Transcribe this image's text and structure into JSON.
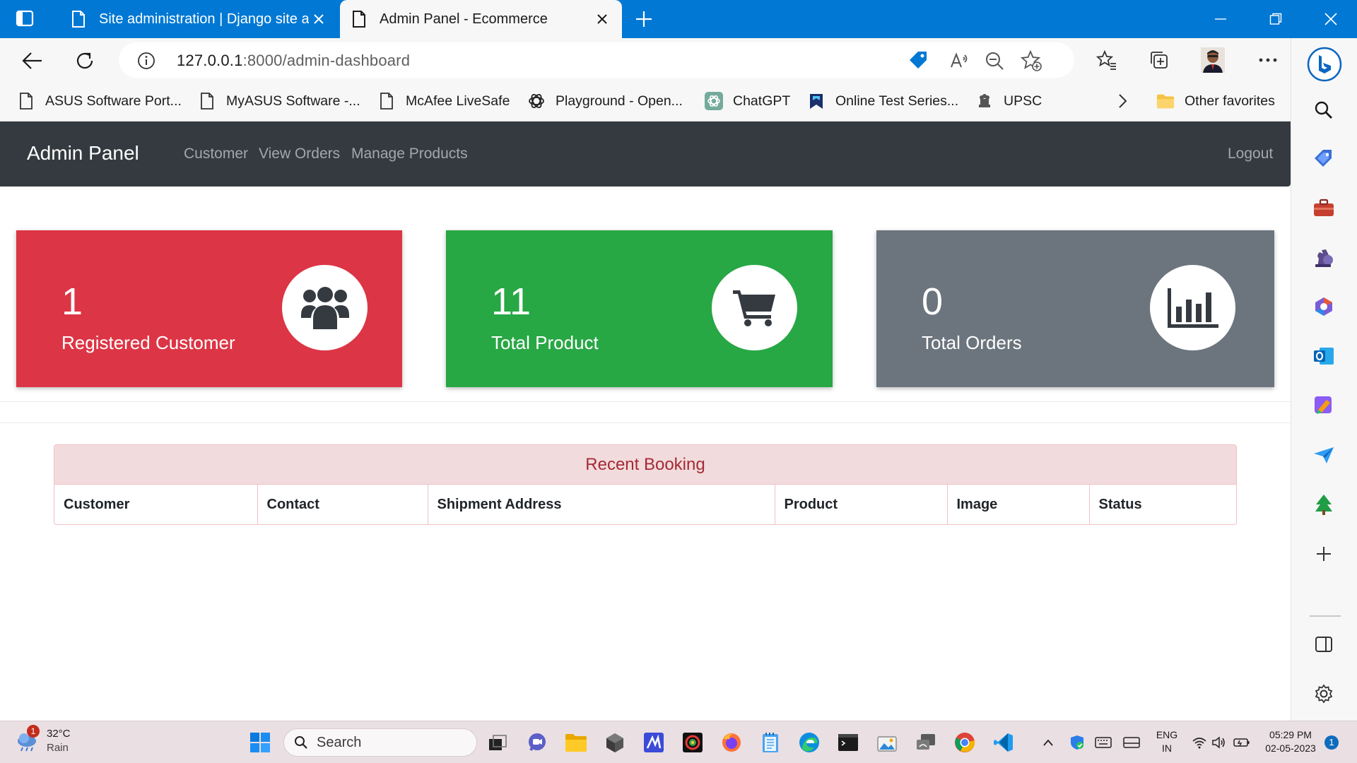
{
  "browser": {
    "tabs": [
      {
        "title": "Site administration | Django site admin",
        "active": false
      },
      {
        "title": "Admin Panel - Ecommerce",
        "active": true
      }
    ],
    "url_host": "127.0.0.1",
    "url_path": ":8000/admin-dashboard",
    "bookmarks": [
      {
        "label": "ASUS Software Port...",
        "icon": "page-icon"
      },
      {
        "label": "MyASUS Software -...",
        "icon": "page-icon"
      },
      {
        "label": "McAfee LiveSafe",
        "icon": "page-icon"
      },
      {
        "label": "Playground - Open...",
        "icon": "openai-icon"
      },
      {
        "label": "ChatGPT",
        "icon": "chatgpt-icon"
      },
      {
        "label": "Online Test Series...",
        "icon": "bookmark-site-icon"
      },
      {
        "label": "UPSC",
        "icon": "emblem-icon"
      }
    ],
    "other_favorites": "Other favorites",
    "accent": "#0078d4"
  },
  "navbar": {
    "brand": "Admin Panel",
    "links": [
      "Customer",
      "View Orders",
      "Manage Products"
    ],
    "logout": "Logout",
    "background": "#343a40"
  },
  "cards": [
    {
      "count": "1",
      "label": "Registered Customer",
      "color": "#dc3545",
      "icon": "users-icon"
    },
    {
      "count": "11",
      "label": "Total Product",
      "color": "#28a745",
      "icon": "cart-icon"
    },
    {
      "count": "0",
      "label": "Total Orders",
      "color": "#6c757d",
      "icon": "bar-chart-icon"
    }
  ],
  "recent_booking": {
    "title": "Recent Booking",
    "columns": [
      "Customer",
      "Contact",
      "Shipment Address",
      "Product",
      "Image",
      "Status"
    ]
  },
  "taskbar": {
    "temperature": "32°C",
    "condition": "Rain",
    "weather_badge": "1",
    "search_label": "Search",
    "language": "ENG",
    "region": "IN",
    "time": "05:29 PM",
    "date": "02-05-2023",
    "notification_count": "1"
  }
}
